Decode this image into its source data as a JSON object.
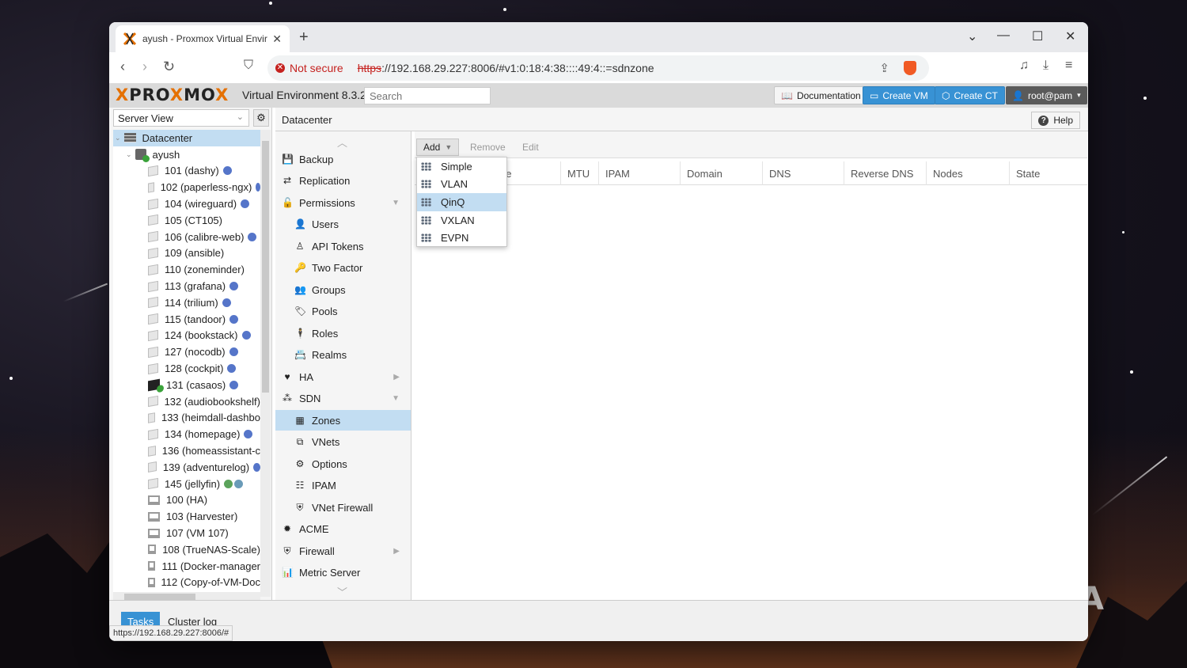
{
  "browser": {
    "tab_title": "ayush - Proxmox Virtual Enviro",
    "security_label": "Not secure",
    "url_scheme": "https",
    "url_rest": "://192.168.29.227:8006/#v1:0:18:4:38::::49:4::=sdnzone",
    "status_url": "https://192.168.29.227:8006/#"
  },
  "header": {
    "logo_text_1": "PRO",
    "logo_text_x": "X",
    "logo_text_2": "MO",
    "logo_text_x2": "X",
    "version": "Virtual Environment 8.3.2",
    "search_placeholder": "Search",
    "documentation": "Documentation",
    "create_vm": "Create VM",
    "create_ct": "Create CT",
    "user": "root@pam"
  },
  "tree": {
    "view": "Server View",
    "datacenter": "Datacenter",
    "node": "ayush",
    "items": [
      {
        "label": "101 (dashy)",
        "kind": "ct",
        "tag": "blue"
      },
      {
        "label": "102 (paperless-ngx)",
        "kind": "ct",
        "tag": "blue"
      },
      {
        "label": "104 (wireguard)",
        "kind": "ct",
        "tag": "blue"
      },
      {
        "label": "105 (CT105)",
        "kind": "ct",
        "tag": ""
      },
      {
        "label": "106 (calibre-web)",
        "kind": "ct",
        "tag": "blue"
      },
      {
        "label": "109 (ansible)",
        "kind": "ct",
        "tag": ""
      },
      {
        "label": "110 (zoneminder)",
        "kind": "ct",
        "tag": ""
      },
      {
        "label": "113 (grafana)",
        "kind": "ct",
        "tag": "blue"
      },
      {
        "label": "114 (trilium)",
        "kind": "ct",
        "tag": "blue"
      },
      {
        "label": "115 (tandoor)",
        "kind": "ct",
        "tag": "blue"
      },
      {
        "label": "124 (bookstack)",
        "kind": "ct",
        "tag": "blue"
      },
      {
        "label": "127 (nocodb)",
        "kind": "ct",
        "tag": "blue"
      },
      {
        "label": "128 (cockpit)",
        "kind": "ct",
        "tag": "blue"
      },
      {
        "label": "131 (casaos)",
        "kind": "ct-running",
        "tag": "blue"
      },
      {
        "label": "132 (audiobookshelf)",
        "kind": "ct",
        "tag": ""
      },
      {
        "label": "133 (heimdall-dashbo",
        "kind": "ct",
        "tag": ""
      },
      {
        "label": "134 (homepage)",
        "kind": "ct",
        "tag": "blue"
      },
      {
        "label": "136 (homeassistant-c",
        "kind": "ct",
        "tag": ""
      },
      {
        "label": "139 (adventurelog)",
        "kind": "ct",
        "tag": "blue"
      },
      {
        "label": "145 (jellyfin)",
        "kind": "ct",
        "tag": "green-teal"
      },
      {
        "label": "100 (HA)",
        "kind": "vm",
        "tag": ""
      },
      {
        "label": "103 (Harvester)",
        "kind": "vm",
        "tag": ""
      },
      {
        "label": "107 (VM 107)",
        "kind": "vm",
        "tag": ""
      },
      {
        "label": "108 (TrueNAS-Scale)",
        "kind": "vm",
        "tag": ""
      },
      {
        "label": "111 (Docker-manager",
        "kind": "vm",
        "tag": ""
      },
      {
        "label": "112 (Copy-of-VM-Doc",
        "kind": "vm",
        "tag": ""
      }
    ]
  },
  "breadcrumb": "Datacenter",
  "help": "Help",
  "menu": {
    "backup": "Backup",
    "replication": "Replication",
    "permissions": "Permissions",
    "users": "Users",
    "api_tokens": "API Tokens",
    "two_factor": "Two Factor",
    "groups": "Groups",
    "pools": "Pools",
    "roles": "Roles",
    "realms": "Realms",
    "ha": "HA",
    "sdn": "SDN",
    "zones": "Zones",
    "vnets": "VNets",
    "options": "Options",
    "ipam": "IPAM",
    "vnet_firewall": "VNet Firewall",
    "acme": "ACME",
    "firewall": "Firewall",
    "metric_server": "Metric Server"
  },
  "toolbar": {
    "add": "Add",
    "remove": "Remove",
    "edit": "Edit"
  },
  "columns": {
    "type_frag": "pe",
    "mtu": "MTU",
    "ipam": "IPAM",
    "domain": "Domain",
    "dns": "DNS",
    "reverse_dns": "Reverse DNS",
    "nodes": "Nodes",
    "state": "State"
  },
  "add_menu": [
    "Simple",
    "VLAN",
    "QinQ",
    "VXLAN",
    "EVPN"
  ],
  "add_menu_highlighted": "QinQ",
  "bottom": {
    "tasks": "Tasks",
    "cluster_log": "Cluster log"
  },
  "watermark": "XDA",
  "colors": {
    "accent": "#3892d4",
    "selection": "#c2ddf2",
    "proxmox_orange": "#e57000",
    "tag_blue": "#5575c9"
  }
}
